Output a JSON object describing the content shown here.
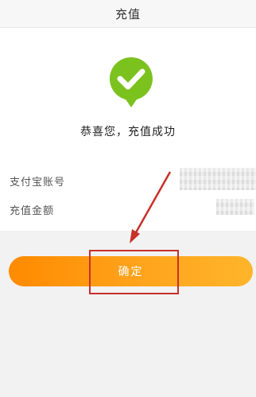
{
  "header": {
    "title": "充值"
  },
  "result": {
    "icon": "check-speech-bubble-icon",
    "message": "恭喜您，充值成功"
  },
  "details": {
    "account_label": "支付宝账号",
    "amount_label": "充值金额"
  },
  "actions": {
    "confirm_label": "确定"
  },
  "colors": {
    "success_green": "#7cc21f",
    "button_orange_start": "#ff8a00",
    "button_orange_end": "#ffb52b",
    "annotation_red": "#c8302a"
  }
}
